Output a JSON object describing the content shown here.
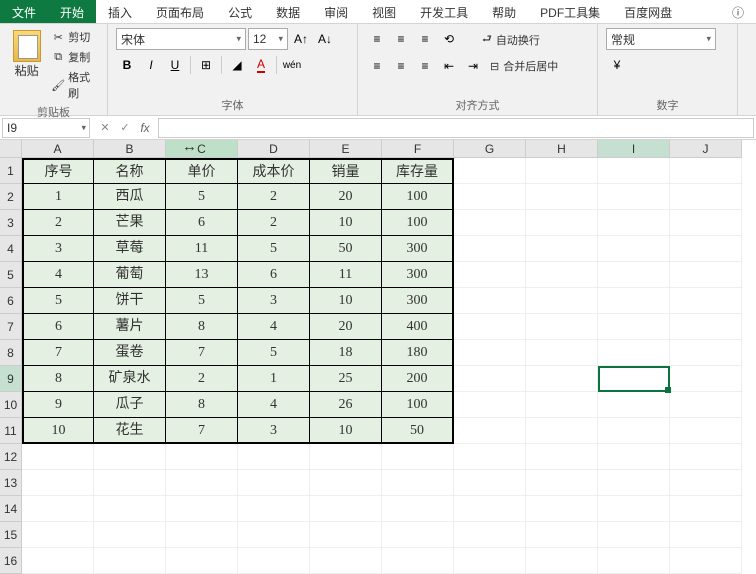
{
  "menu": {
    "file": "文件",
    "home": "开始",
    "insert": "插入",
    "layout": "页面布局",
    "formula": "公式",
    "data": "数据",
    "review": "审阅",
    "view": "视图",
    "dev": "开发工具",
    "help": "帮助",
    "pdf": "PDF工具集",
    "baidu": "百度网盘"
  },
  "ribbon": {
    "clipboard": {
      "paste": "粘贴",
      "cut": "剪切",
      "copy": "复制",
      "format": "格式刷",
      "label": "剪贴板"
    },
    "font": {
      "name": "宋体",
      "size": "12",
      "label": "字体",
      "bold": "B",
      "italic": "I",
      "underline": "U",
      "wen": "wén"
    },
    "align": {
      "wrap": "自动换行",
      "merge": "合并后居中",
      "label": "对齐方式"
    },
    "number": {
      "format": "常规",
      "label": "数字"
    }
  },
  "formulabar": {
    "name": "I9",
    "fx": "fx"
  },
  "columns": [
    "A",
    "B",
    "C",
    "D",
    "E",
    "F",
    "G",
    "H",
    "I",
    "J"
  ],
  "rows": [
    "1",
    "2",
    "3",
    "4",
    "5",
    "6",
    "7",
    "8",
    "9",
    "10",
    "11",
    "12",
    "13",
    "14",
    "15",
    "16"
  ],
  "table": {
    "headers": [
      "序号",
      "名称",
      "单价",
      "成本价",
      "销量",
      "库存量"
    ],
    "data": [
      [
        "1",
        "西瓜",
        "5",
        "2",
        "20",
        "100"
      ],
      [
        "2",
        "芒果",
        "6",
        "2",
        "10",
        "100"
      ],
      [
        "3",
        "草莓",
        "11",
        "5",
        "50",
        "300"
      ],
      [
        "4",
        "葡萄",
        "13",
        "6",
        "11",
        "300"
      ],
      [
        "5",
        "饼干",
        "5",
        "3",
        "10",
        "300"
      ],
      [
        "6",
        "薯片",
        "8",
        "4",
        "20",
        "400"
      ],
      [
        "7",
        "蛋卷",
        "7",
        "5",
        "18",
        "180"
      ],
      [
        "8",
        "矿泉水",
        "2",
        "1",
        "25",
        "200"
      ],
      [
        "9",
        "瓜子",
        "8",
        "4",
        "26",
        "100"
      ],
      [
        "10",
        "花生",
        "7",
        "3",
        "10",
        "50"
      ]
    ]
  }
}
